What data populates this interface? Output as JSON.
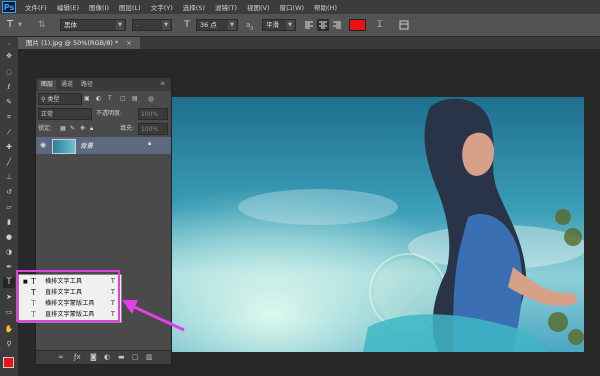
{
  "app": {
    "logo": "Ps"
  },
  "menu": [
    "文件(F)",
    "编辑(E)",
    "图像(I)",
    "图层(L)",
    "文字(Y)",
    "选择(S)",
    "滤镜(T)",
    "视图(V)",
    "窗口(W)",
    "帮助(H)"
  ],
  "options": {
    "tool_icon": "T",
    "font_family": "黑体",
    "font_style": "-",
    "font_size_icon": "T",
    "font_size": "36 点",
    "aa_label": "a",
    "antialias": "平滑",
    "text_color": "#ee1111"
  },
  "document_tab": {
    "title": "图片 (1).jpg @ 50%(RGB/8) *",
    "close": "×"
  },
  "layers_panel": {
    "tabs": [
      "图层",
      "通道",
      "路径"
    ],
    "filter_label": "类型",
    "blend_mode": "正常",
    "opacity_label": "不透明度:",
    "opacity_value": "100%",
    "lock_label": "锁定:",
    "fill_label": "填充:",
    "fill_value": "100%",
    "layer_name": "背景"
  },
  "type_tools_flyout": [
    {
      "label": "横排文字工具",
      "shortcut": "T",
      "active": true
    },
    {
      "label": "直排文字工具",
      "shortcut": "T",
      "active": false
    },
    {
      "label": "横排文字蒙版工具",
      "shortcut": "T",
      "active": false
    },
    {
      "label": "直排文字蒙版工具",
      "shortcut": "T",
      "active": false
    }
  ],
  "colors": {
    "highlight": "#e33fe6",
    "foreground": "#ee1111",
    "accent": "#31a8ff"
  }
}
